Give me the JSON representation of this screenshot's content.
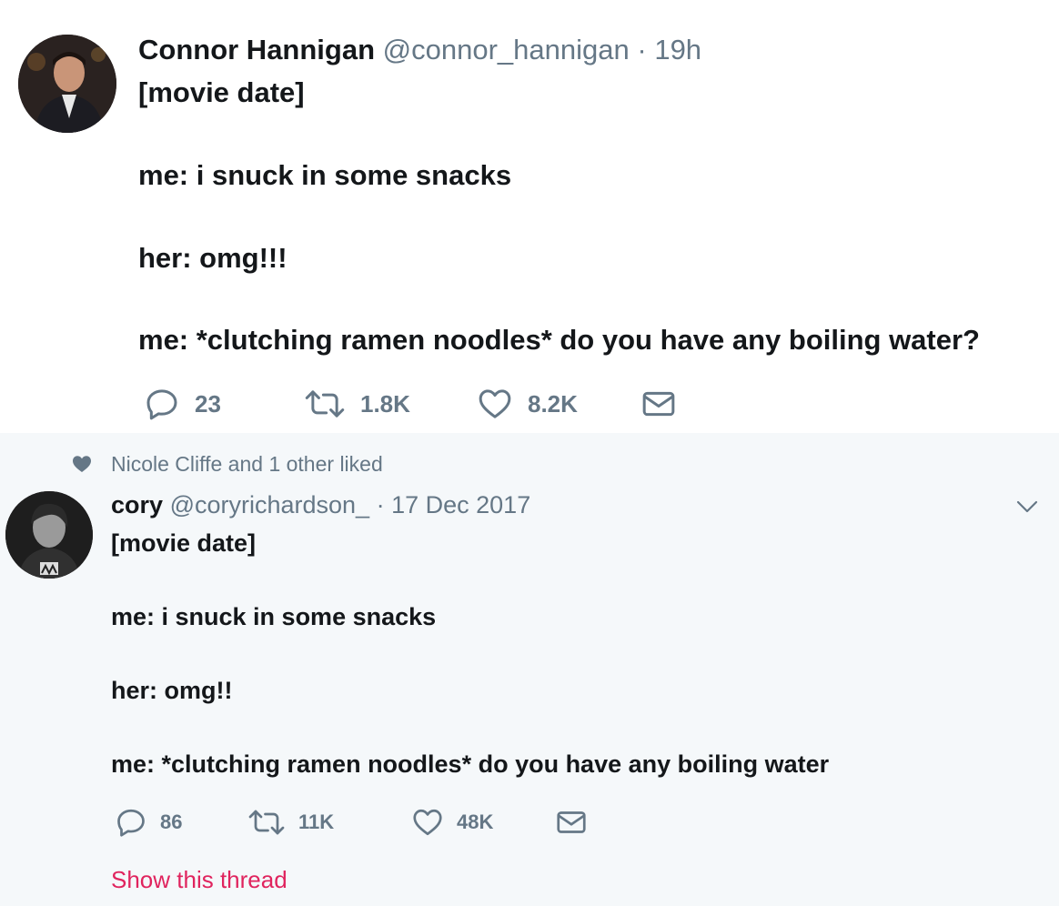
{
  "colors": {
    "text": "#14171a",
    "secondary": "#657786",
    "link_red": "#e0245e",
    "background_alt": "#f5f8fa"
  },
  "tweet1": {
    "author_name": "Connor Hannigan",
    "handle": "@connor_hannigan",
    "separator": "·",
    "time": "19h",
    "text_lines": [
      "[movie date]",
      "me: i snuck in some snacks",
      "her: omg!!!",
      "me: *clutching ramen noodles* do you have any boiling water?"
    ],
    "actions": {
      "reply_icon": "reply-icon",
      "reply_count": "23",
      "retweet_icon": "retweet-icon",
      "retweet_count": "1.8K",
      "like_icon": "heart-icon",
      "like_count": "8.2K",
      "dm_icon": "envelope-icon"
    }
  },
  "tweet2": {
    "social_context_icon": "heart-filled-icon",
    "social_context": "Nicole Cliffe and 1 other liked",
    "author_name": "cory",
    "handle": "@coryrichardson_",
    "separator": "·",
    "time": "17 Dec 2017",
    "menu_icon": "chevron-down-icon",
    "text_lines": [
      "[movie date]",
      "me: i snuck in some snacks",
      "her: omg!!",
      "me: *clutching ramen noodles* do you have any boiling water"
    ],
    "actions": {
      "reply_icon": "reply-icon",
      "reply_count": "86",
      "retweet_icon": "retweet-icon",
      "retweet_count": "11K",
      "like_icon": "heart-icon",
      "like_count": "48K",
      "dm_icon": "envelope-icon"
    },
    "show_thread_label": "Show this thread"
  }
}
